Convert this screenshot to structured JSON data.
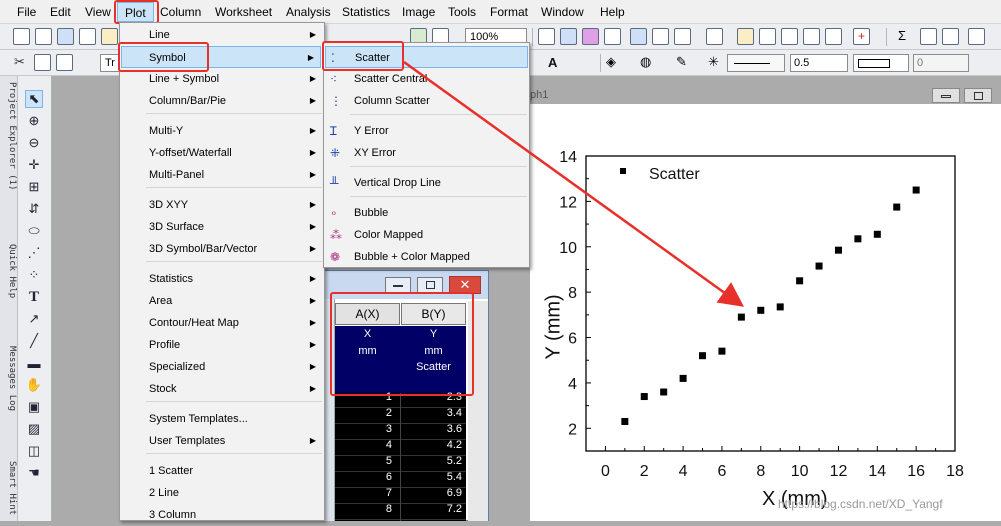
{
  "menubar": [
    "File",
    "Edit",
    "View",
    "Plot",
    "Column",
    "Worksheet",
    "Analysis",
    "Statistics",
    "Image",
    "Tools",
    "Format",
    "Window",
    "Help"
  ],
  "toolbar": {
    "zoom": "100%",
    "font_sample": "Tr",
    "line_width": "0.5",
    "angle": "0"
  },
  "side_tabs": [
    "Project Explorer (1)",
    "Quick Help",
    "Messages Log",
    "Smart Hint"
  ],
  "plot_menu": {
    "items": [
      {
        "label": "Line",
        "arrow": true
      },
      {
        "label": "Symbol",
        "arrow": true
      },
      {
        "label": "Line + Symbol",
        "arrow": true
      },
      {
        "label": "Column/Bar/Pie",
        "arrow": true
      },
      {
        "label": "Multi-Y",
        "arrow": true
      },
      {
        "label": "Y-offset/Waterfall",
        "arrow": true
      },
      {
        "label": "Multi-Panel",
        "arrow": true
      },
      {
        "label": "3D XYY",
        "arrow": true
      },
      {
        "label": "3D Surface",
        "arrow": true
      },
      {
        "label": "3D Symbol/Bar/Vector",
        "arrow": true
      },
      {
        "label": "Statistics",
        "arrow": true
      },
      {
        "label": "Area",
        "arrow": true
      },
      {
        "label": "Contour/Heat Map",
        "arrow": true
      },
      {
        "label": "Profile",
        "arrow": true
      },
      {
        "label": "Specialized",
        "arrow": true
      },
      {
        "label": "Stock",
        "arrow": true
      },
      {
        "label": "System Templates...",
        "arrow": false
      },
      {
        "label": "User Templates",
        "arrow": true
      },
      {
        "label": "1 Scatter",
        "arrow": false
      },
      {
        "label": "2 Line",
        "arrow": false
      },
      {
        "label": "3 Column",
        "arrow": false
      }
    ]
  },
  "symbol_menu": {
    "items": [
      "Scatter",
      "Scatter Central",
      "Column Scatter",
      "Y Error",
      "XY Error",
      "Vertical Drop Line",
      "Bubble",
      "Color Mapped",
      "Bubble + Color Mapped"
    ]
  },
  "graph_window": {
    "title_fragment": "ph1"
  },
  "worksheet": {
    "headers": [
      "A(X)",
      "B(Y)"
    ],
    "long_name": [
      "X",
      "Y"
    ],
    "units": [
      "mm",
      "mm"
    ],
    "comments": [
      "",
      "Scatter"
    ],
    "rows": [
      [
        "1",
        "2.3"
      ],
      [
        "2",
        "3.4"
      ],
      [
        "3",
        "3.6"
      ],
      [
        "4",
        "4.2"
      ],
      [
        "5",
        "5.2"
      ],
      [
        "6",
        "5.4"
      ],
      [
        "7",
        "6.9"
      ],
      [
        "8",
        "7.2"
      ]
    ]
  },
  "chart_data": {
    "type": "scatter",
    "series": [
      {
        "name": "Scatter",
        "x": [
          1,
          2,
          3,
          4,
          5,
          6,
          7,
          8,
          9,
          10,
          11,
          12,
          13,
          14,
          15,
          16
        ],
        "y": [
          2.3,
          3.4,
          3.6,
          4.2,
          5.2,
          5.4,
          6.9,
          7.2,
          7.35,
          8.5,
          9.15,
          9.85,
          10.35,
          10.55,
          11.75,
          12.5
        ]
      }
    ],
    "xlabel": "X (mm)",
    "ylabel": "Y (mm)",
    "xlim": [
      -1,
      18
    ],
    "ylim": [
      1,
      14
    ],
    "xticks": [
      0,
      2,
      4,
      6,
      8,
      10,
      12,
      14,
      16,
      18
    ],
    "yticks": [
      2,
      4,
      6,
      8,
      10,
      12,
      14
    ],
    "legend": "top-left",
    "marker_color": "#000000"
  },
  "watermark": "https://blog.csdn.net/XD_Yangf",
  "colors": {
    "highlight": "#cce4f7",
    "annotation": "#e8302a",
    "worksheet_bg": "#000066"
  }
}
